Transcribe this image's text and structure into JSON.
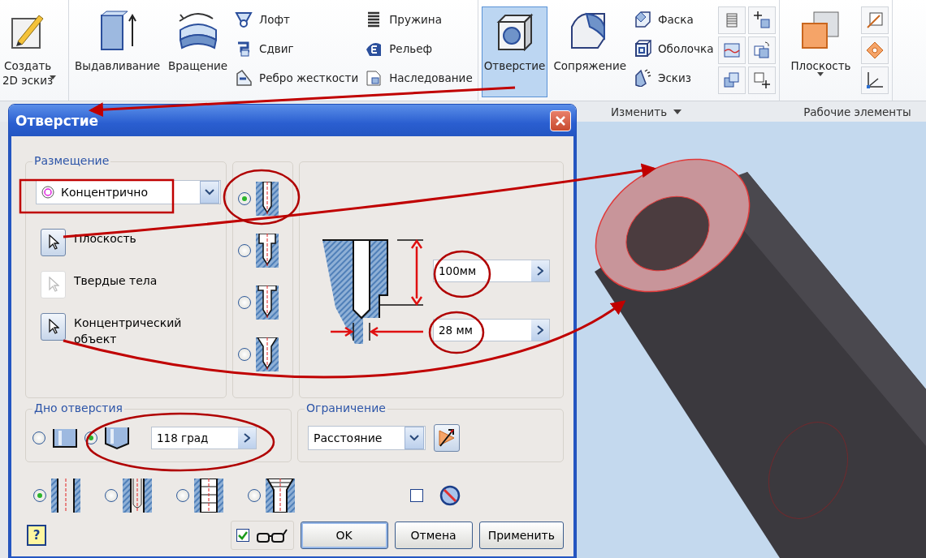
{
  "ribbon": {
    "create_sketch": [
      "Создать",
      "2D эскиз"
    ],
    "tools": [
      {
        "label": "Выдавливание"
      },
      {
        "label": "Вращение"
      }
    ],
    "feature_columns": [
      [
        "Лофт",
        "Сдвиг",
        "Ребро жесткости"
      ],
      [
        "Пружина",
        "Рельеф",
        "Наследование"
      ]
    ],
    "modify_tools": [
      {
        "label": "Отверстие",
        "selected": true
      },
      {
        "label": "Сопряжение",
        "selected": false
      }
    ],
    "modify_column": [
      "Фаска",
      "Оболочка",
      "Эскиз"
    ],
    "work_plane": {
      "label": "Плоскость"
    },
    "panels": [
      {
        "label": "Изменить",
        "dropdown": true
      },
      {
        "label": "Рабочие элементы",
        "dropdown": false
      }
    ]
  },
  "dialog": {
    "title": "Отверстие",
    "placement": {
      "legend": "Размещение",
      "mode": "Концентрично",
      "selectors": [
        {
          "label": "Плоскость",
          "enabled": true
        },
        {
          "label": "Твердые тела",
          "enabled": false
        },
        {
          "label": "Концентрический объект",
          "enabled": true
        }
      ]
    },
    "hole_types": [
      {
        "selected": true
      },
      {
        "selected": false
      },
      {
        "selected": false
      },
      {
        "selected": false
      }
    ],
    "depth": "100мм",
    "diameter": "28 мм",
    "drill_point": {
      "legend": "Дно отверстия",
      "options": [
        {
          "kind": "flat",
          "selected": false
        },
        {
          "kind": "angle",
          "selected": true
        }
      ],
      "angle": "118 град"
    },
    "termination": {
      "legend": "Ограничение",
      "value": "Расстояние"
    },
    "thread_types": [
      {
        "selected": true
      },
      {
        "selected": false
      },
      {
        "selected": false
      },
      {
        "selected": false
      }
    ],
    "flip_checked": false,
    "preview_checked": true,
    "help": "?",
    "buttons": [
      "OK",
      "Отмена",
      "Применить"
    ]
  }
}
